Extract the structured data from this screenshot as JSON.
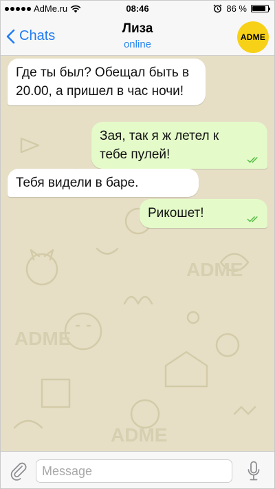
{
  "status_bar": {
    "carrier": "AdMe.ru",
    "time": "08:46",
    "battery_percent": "86 %",
    "battery_level": 0.86
  },
  "nav": {
    "back_label": "Chats",
    "contact_name": "Лиза",
    "contact_status": "online",
    "avatar_text": "ADME",
    "avatar_color": "#f7d117"
  },
  "messages": [
    {
      "direction": "incoming",
      "text": "Где ты был? Обещал быть в 20.00, а пришел в час ночи!"
    },
    {
      "direction": "outgoing",
      "text": "Зая, так я ж летел к тебе пулей!",
      "read": true
    },
    {
      "direction": "incoming",
      "text": "Тебя видели в баре."
    },
    {
      "direction": "outgoing",
      "text": "Рикошет!",
      "read": true
    }
  ],
  "input": {
    "placeholder": "Message",
    "value": ""
  },
  "icons": {
    "back": "chevron-left-icon",
    "attach": "paperclip-icon",
    "mic": "microphone-icon",
    "read": "double-check-icon"
  },
  "colors": {
    "accent": "#1f7cf5",
    "chat_background": "#e6dfc6",
    "outgoing_bubble": "#e4fbc9",
    "incoming_bubble": "#ffffff",
    "check_marks": "#4fb83f"
  }
}
